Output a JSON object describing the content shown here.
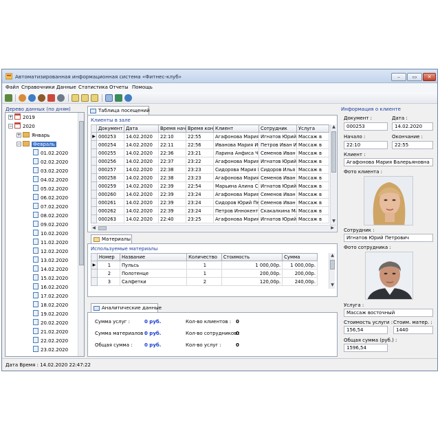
{
  "window": {
    "title": "Автоматизированная информационная система «Фитнес-клуб»",
    "controls": [
      "–",
      "▭",
      "✕"
    ]
  },
  "menu": [
    "Файл",
    "Справочники",
    "Данные",
    "Статистика",
    "Отчеты",
    "Помощь"
  ],
  "toolbar_icons": [
    "exit-icon",
    "clients-icon",
    "staff-icon",
    "user-icon",
    "settings-icon",
    "search-icon",
    "report-icon",
    "report-icon",
    "report-icon",
    "table-icon",
    "books-icon",
    "user-icon"
  ],
  "tree": {
    "caption": "Дерево данных (по дням)",
    "years": [
      {
        "label": "2019",
        "expanded": false
      },
      {
        "label": "2020",
        "expanded": true
      }
    ],
    "months": [
      {
        "label": "Январь",
        "expanded": false
      },
      {
        "label": "Февраль",
        "expanded": true,
        "selected": true
      }
    ],
    "days": [
      "01.02.2020",
      "02.02.2020",
      "03.02.2020",
      "04.02.2020",
      "05.02.2020",
      "06.02.2020",
      "07.02.2020",
      "08.02.2020",
      "09.02.2020",
      "10.02.2020",
      "11.02.2020",
      "12.02.2020",
      "13.02.2020",
      "14.02.2020",
      "15.02.2020",
      "16.02.2020",
      "17.02.2020",
      "18.02.2020",
      "19.02.2020",
      "20.02.2020",
      "21.02.2020",
      "22.02.2020",
      "23.02.2020"
    ]
  },
  "visits": {
    "tab": "Таблица посещений",
    "caption": "Клиенты в зале",
    "columns": [
      "Документ",
      "Дата",
      "Время нач",
      "Время кон",
      "Клиент",
      "Сотрудник",
      "Услуга"
    ],
    "rows": [
      [
        "000253",
        "14.02.2020",
        "22:10",
        "22:55",
        "Агафонова Мария",
        "Игнатов Юрий",
        "Массаж в"
      ],
      [
        "000254",
        "14.02.2020",
        "22:11",
        "22:56",
        "Иванова Мария Ив",
        "Петров Иван Иван",
        "Массаж в"
      ],
      [
        "000255",
        "14.02.2020",
        "22:36",
        "23:21",
        "Ларина Анфиса Че",
        "Семенов Иван Вас",
        "Массаж в"
      ],
      [
        "000256",
        "14.02.2020",
        "22:37",
        "23:22",
        "Агафонова Мария",
        "Игнатов Юрий Пет",
        "Массаж в"
      ],
      [
        "000257",
        "14.02.2020",
        "22:38",
        "23:23",
        "Сидорова Мария М",
        "Сидоров Илья Ива",
        "Массаж в"
      ],
      [
        "000258",
        "14.02.2020",
        "22:38",
        "23:23",
        "Агафонова Мария",
        "Семенов Иван Вас",
        "Массаж в"
      ],
      [
        "000259",
        "14.02.2020",
        "22:39",
        "22:54",
        "Марьина Алина Се",
        "Игнатов Юрий Пет",
        "Массаж в"
      ],
      [
        "000260",
        "14.02.2020",
        "22:39",
        "23:24",
        "Агафонова Мария",
        "Семенов Иван Вас",
        "Массаж в"
      ],
      [
        "000261",
        "14.02.2020",
        "22:39",
        "23:24",
        "Сидоров Юрий Пет",
        "Семенов Иван Вас",
        "Массаж в"
      ],
      [
        "000262",
        "14.02.2020",
        "22:39",
        "23:24",
        "Петров Иннокенти",
        "Скакалкина Мария",
        "Массаж в"
      ],
      [
        "000263",
        "14.02.2020",
        "22:40",
        "23:25",
        "Агафонова Мария",
        "Игнатов Юрий Пет",
        "Массаж в"
      ]
    ]
  },
  "materials": {
    "tab": "Материалы",
    "caption": "Используемые материалы",
    "columns": [
      "Номер",
      "Название",
      "Количество",
      "Стоимость",
      "Сумма"
    ],
    "rows": [
      [
        "1",
        "Пульсь",
        "1",
        "1 000,00р.",
        "1 000,00р."
      ],
      [
        "2",
        "Полотенце",
        "1",
        "200,00р.",
        "200,00р."
      ],
      [
        "3",
        "Салфетки",
        "2",
        "120,00р.",
        "240,00р."
      ]
    ]
  },
  "analytics": {
    "tab": "Аналитические данные",
    "services_sum_label": "Сумма услуг :",
    "services_sum_value": "0 руб.",
    "materials_sum_label": "Сумма материалов :",
    "materials_sum_value": "0 руб.",
    "total_label": "Общая сумма :",
    "total_value": "0 руб.",
    "clients_label": "Кол-во клиентов :",
    "clients_value": "0",
    "staff_label": "Кол-во сотрудников :",
    "staff_value": "0",
    "services_label": "Кол-во услуг :",
    "services_value": "0"
  },
  "client_info": {
    "title": "Информация о клиенте",
    "doc_label": "Документ :",
    "doc_value": "000253",
    "date_label": "Дата :",
    "date_value": "14.02.2020",
    "start_label": "Начало :",
    "start_value": "22:10",
    "end_label": "Окончание :",
    "end_value": "22:55",
    "client_label": "Клиент :",
    "client_value": "Агафонова Мария Валерьяновна",
    "client_photo_label": "Фото клиента :",
    "staff_label": "Сотрудник :",
    "staff_value": "Игнатов Юрий Петрович",
    "staff_photo_label": "Фото сотрудника :",
    "service_label": "Услуга :",
    "service_value": "Массаж восточный",
    "service_cost_label": "Стоимость услуги :",
    "service_cost_value": "156,54",
    "material_cost_label": "Стоим. матер. :",
    "material_cost_value": "1440",
    "total_label": "Общая сумма (руб.) :",
    "total_value": "1596,54"
  },
  "status": {
    "text": "Дата Время : 14.02.2020 22:47:22"
  },
  "colors": {
    "accent_blue": "#1a3c9e",
    "selection": "#3c73c9",
    "window_bg": "#f0f0f0"
  }
}
